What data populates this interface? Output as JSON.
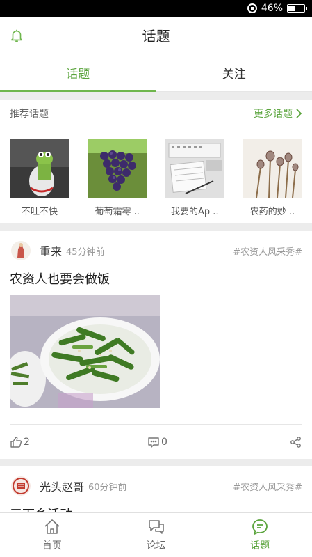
{
  "status_bar": {
    "battery": "46%",
    "battery_level": 0.46
  },
  "header": {
    "title": "话题",
    "bell_icon": "bell-icon"
  },
  "tabs": [
    {
      "label": "话题",
      "active": true
    },
    {
      "label": "关注",
      "active": false
    }
  ],
  "recommended": {
    "title": "推荐话题",
    "more_label": "更多话题",
    "items": [
      {
        "label": "不吐不快"
      },
      {
        "label": "葡萄霜霉 .."
      },
      {
        "label": "我要的Ap .."
      },
      {
        "label": "农药的妙 .."
      }
    ]
  },
  "posts": [
    {
      "author": "重来",
      "time": "45分钟前",
      "tag": "#农资人风采秀#",
      "title": "农资人也要会做饭",
      "likes": "2",
      "comments": "0"
    },
    {
      "author": "光头赵哥",
      "time": "60分钟前",
      "tag": "#农资人风采秀#",
      "title": "三下乡活动"
    }
  ],
  "bottom_nav": [
    {
      "label": "首页",
      "icon": "home-icon",
      "active": false
    },
    {
      "label": "论坛",
      "icon": "forum-icon",
      "active": false
    },
    {
      "label": "话题",
      "icon": "topic-icon",
      "active": true
    }
  ],
  "colors": {
    "accent": "#5aa43c",
    "text": "#222222",
    "muted": "#999999"
  }
}
